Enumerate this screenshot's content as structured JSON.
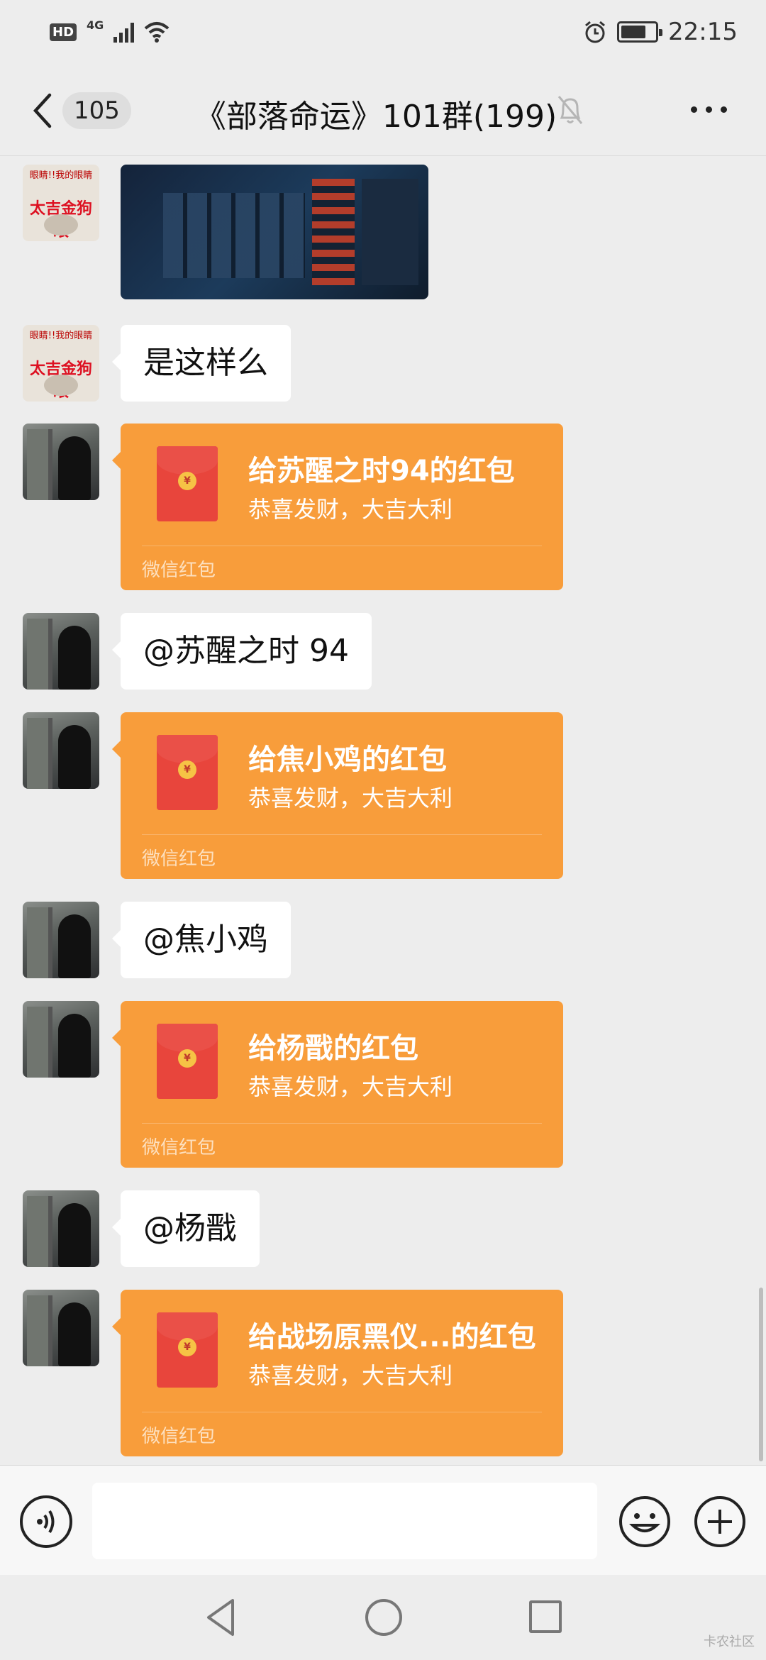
{
  "status_bar": {
    "hd": "HD",
    "network": "4G",
    "time": "22:15"
  },
  "header": {
    "unread_count": "105",
    "title": "《部落命运》101群(199)"
  },
  "messages": [
    {
      "type": "image",
      "avatar": "meme"
    },
    {
      "type": "text",
      "avatar": "meme",
      "text": "是这样么"
    },
    {
      "type": "red_packet",
      "avatar": "photo",
      "title": "给苏醒之时94的红包",
      "subtitle": "恭喜发财，大吉大利",
      "footer": "微信红包"
    },
    {
      "type": "text",
      "avatar": "photo",
      "text": "@苏醒之时 94"
    },
    {
      "type": "red_packet",
      "avatar": "photo",
      "title": "给焦小鸡的红包",
      "subtitle": "恭喜发财，大吉大利",
      "footer": "微信红包"
    },
    {
      "type": "text",
      "avatar": "photo",
      "text": "@焦小鸡"
    },
    {
      "type": "red_packet",
      "avatar": "photo",
      "title": "给杨戬的红包",
      "subtitle": "恭喜发财，大吉大利",
      "footer": "微信红包"
    },
    {
      "type": "text",
      "avatar": "photo",
      "text": "@杨戬"
    },
    {
      "type": "red_packet",
      "avatar": "photo",
      "title": "给战场原黑仪...的红包",
      "subtitle": "恭喜发财，大吉大利",
      "footer": "微信红包"
    }
  ],
  "meme_avatar": {
    "top_text": "眼睛!!我的眼睛",
    "mid_text": "太吉金狗眼"
  },
  "input": {
    "value": ""
  },
  "watermark": "卡农社区",
  "colors": {
    "background": "#ededed",
    "red_packet": "#f89d3b",
    "envelope": "#e8453c"
  },
  "icons": [
    "back-icon",
    "mute-bell-icon",
    "more-icon",
    "voice-icon",
    "emoji-icon",
    "plus-icon",
    "nav-back-icon",
    "nav-home-icon",
    "nav-recent-icon"
  ]
}
